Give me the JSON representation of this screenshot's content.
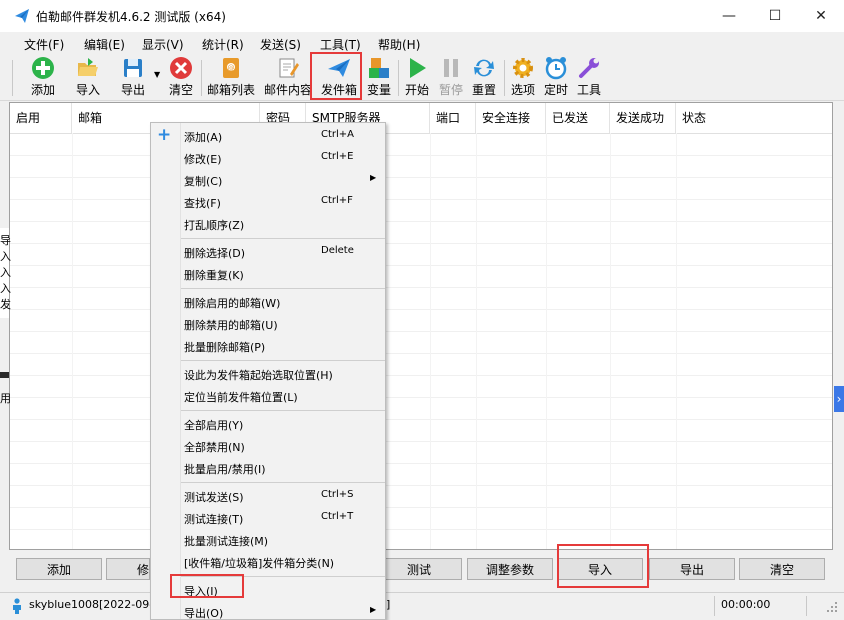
{
  "window": {
    "title": "伯勒邮件群发机4.6.2 测试版 (x64)",
    "minimize_glyph": "—",
    "maximize_glyph": "☐",
    "close_glyph": "✕"
  },
  "menu": [
    "文件(F)",
    "编辑(E)",
    "显示(V)",
    "统计(R)",
    "发送(S)",
    "工具(T)",
    "帮助(H)"
  ],
  "toolbar": {
    "add": "添加",
    "import": "导入",
    "export": "导出",
    "clear": "清空",
    "mailbox_list": "邮箱列表",
    "mail_content": "邮件内容",
    "sender_box": "发件箱",
    "variables": "变量",
    "start": "开始",
    "pause": "暂停",
    "reset": "重置",
    "options": "选项",
    "schedule": "定时",
    "tools": "工具"
  },
  "columns": [
    "启用",
    "邮箱",
    "密码",
    "SMTP服务器",
    "端口",
    "安全连接",
    "已发送",
    "发送成功",
    "状态"
  ],
  "buttons": {
    "add": "添加",
    "edit_partial": "修",
    "test": "测试",
    "adjust_params": "调整参数",
    "import": "导入",
    "export": "导出",
    "clear": "清空"
  },
  "status": {
    "user": "skyblue1008[2022-09-",
    "bracket": "]",
    "timer": "00:00:00"
  },
  "context_menu": [
    {
      "label": "添加(A)",
      "shortcut": "Ctrl+A"
    },
    {
      "label": "修改(E)",
      "shortcut": "Ctrl+E"
    },
    {
      "label": "复制(C)",
      "shortcut": ""
    },
    {
      "label": "查找(F)",
      "shortcut": "Ctrl+F"
    },
    {
      "label": "打乱顺序(Z)",
      "shortcut": ""
    },
    {
      "label": "删除选择(D)",
      "shortcut": "Delete"
    },
    {
      "label": "删除重复(K)",
      "shortcut": ""
    },
    {
      "label": "删除启用的邮箱(W)",
      "shortcut": ""
    },
    {
      "label": "删除禁用的邮箱(U)",
      "shortcut": ""
    },
    {
      "label": "批量删除邮箱(P)",
      "shortcut": ""
    },
    {
      "label": "设此为发件箱起始选取位置(H)",
      "shortcut": ""
    },
    {
      "label": "定位当前发件箱位置(L)",
      "shortcut": ""
    },
    {
      "label": "全部启用(Y)",
      "shortcut": ""
    },
    {
      "label": "全部禁用(N)",
      "shortcut": ""
    },
    {
      "label": "批量启用/禁用(I)",
      "shortcut": ""
    },
    {
      "label": "测试发送(S)",
      "shortcut": "Ctrl+S"
    },
    {
      "label": "测试连接(T)",
      "shortcut": "Ctrl+T"
    },
    {
      "label": "批量测试连接(M)",
      "shortcut": ""
    },
    {
      "label": "[收件箱/垃圾箱]发件箱分类(N)",
      "shortcut": ""
    },
    {
      "label": "导入(I)",
      "shortcut": ""
    },
    {
      "label": "导出(O)",
      "shortcut": ""
    }
  ],
  "background_fragments": [
    "导",
    "入",
    "入",
    "入",
    "发",
    "用"
  ],
  "background_arrow": "›",
  "colors": {
    "highlight": "#e53a3a",
    "accent_blue": "#2f8be0"
  }
}
